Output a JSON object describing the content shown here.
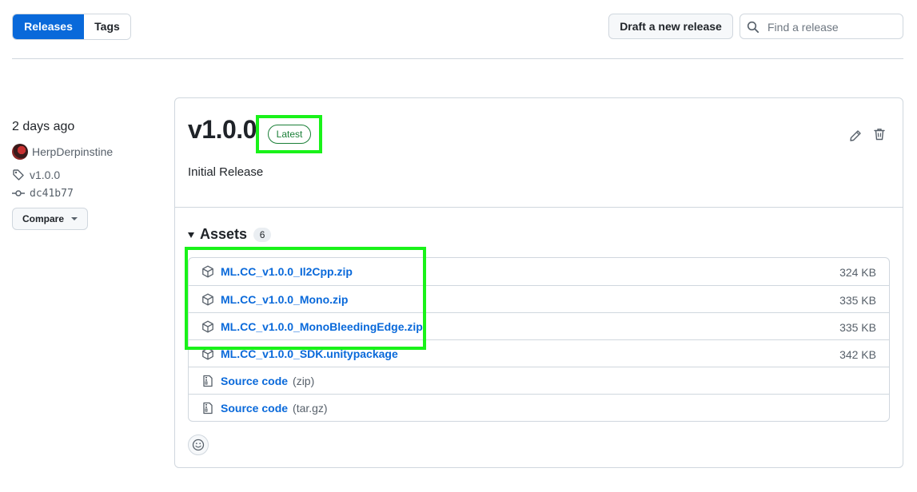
{
  "header": {
    "tabs": [
      {
        "label": "Releases",
        "active": true
      },
      {
        "label": "Tags",
        "active": false
      }
    ],
    "draft_button": "Draft a new release",
    "search_placeholder": "Find a release"
  },
  "release_meta": {
    "time": "2 days ago",
    "author": "HerpDerpinstine",
    "tag": "v1.0.0",
    "commit": "dc41b77",
    "compare_label": "Compare"
  },
  "release": {
    "version": "v1.0.0",
    "badge": "Latest",
    "notes": "Initial Release",
    "assets_title": "Assets",
    "assets_count": "6",
    "assets": [
      {
        "name": "ML.CC_v1.0.0_Il2Cpp.zip",
        "size": "324 KB",
        "icon": "package-icon"
      },
      {
        "name": "ML.CC_v1.0.0_Mono.zip",
        "size": "335 KB",
        "icon": "package-icon"
      },
      {
        "name": "ML.CC_v1.0.0_MonoBleedingEdge.zip",
        "size": "335 KB",
        "icon": "package-icon"
      },
      {
        "name": "ML.CC_v1.0.0_SDK.unitypackage",
        "size": "342 KB",
        "icon": "package-icon"
      },
      {
        "name": "Source code",
        "sub": "(zip)",
        "icon": "file-zip-icon"
      },
      {
        "name": "Source code",
        "sub": "(tar.gz)",
        "icon": "file-zip-icon"
      }
    ]
  },
  "colors": {
    "accent": "#0969da",
    "latest": "#1a7f37",
    "highlight": "#19f219",
    "border": "#d0d7de"
  }
}
